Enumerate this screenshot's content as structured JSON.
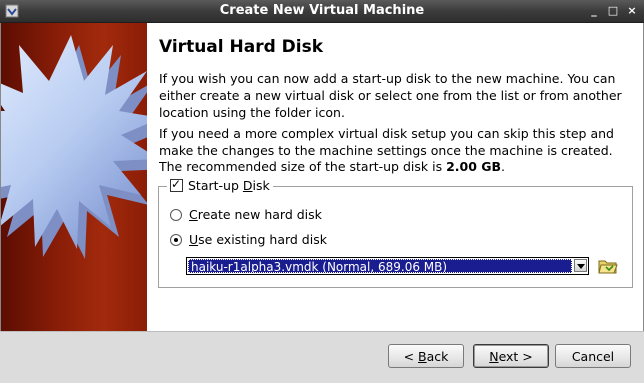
{
  "window": {
    "title": "Create New Virtual Machine",
    "controls": [
      "_",
      "□",
      "×"
    ]
  },
  "page": {
    "heading": "Virtual Hard Disk",
    "para1_line1": "If you wish you can now add a start-up disk to the new machine. You can",
    "para1_line2": "either create a new virtual disk or select one from the list or from another",
    "para1_line3": "location using the folder icon.",
    "para2_line1": "If you need a more complex virtual disk setup you can skip this step and",
    "para2_line2": "make the changes to the machine settings once the machine is created.",
    "recommend_prefix": "The recommended size of the start-up disk is ",
    "recommend_size": "2.00 GB",
    "recommend_suffix": "."
  },
  "startup_disk": {
    "checked": true,
    "label_pre": "Start-up ",
    "label_accel": "D",
    "label_post": "isk",
    "option_create": {
      "accel": "C",
      "rest": "reate new hard disk",
      "selected": false
    },
    "option_existing": {
      "accel": "U",
      "rest": "se existing hard disk",
      "selected": true
    },
    "selected_disk": "haiku-r1alpha3.vmdk (Normal, 689.06 MB)",
    "folder_icon": "folder-open-icon"
  },
  "buttons": {
    "back_pre": "< ",
    "back_accel": "B",
    "back_rest": "ack",
    "next_accel": "N",
    "next_rest": "ext >",
    "cancel": "Cancel"
  },
  "colors": {
    "banner": "#8a1e08",
    "selection": "#1a1d8f",
    "titlebar": "#3c3c3c"
  }
}
